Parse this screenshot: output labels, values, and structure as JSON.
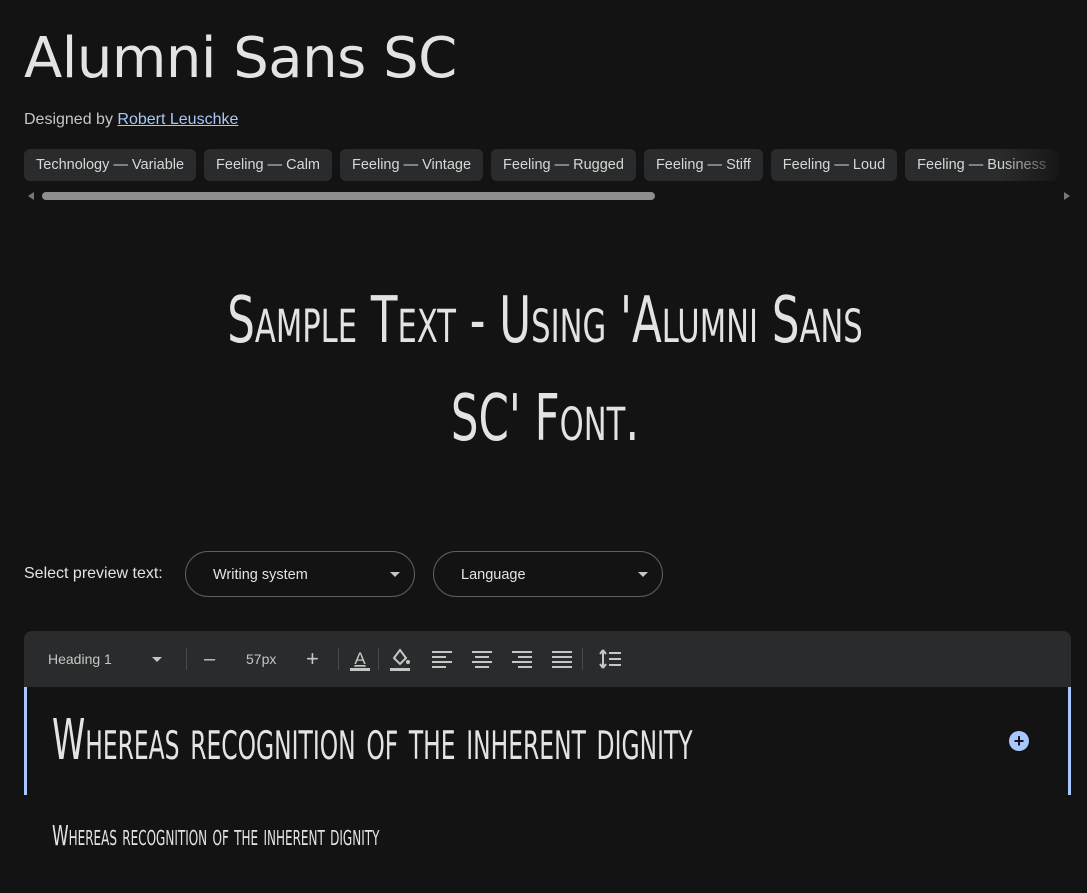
{
  "font": {
    "name": "Alumni Sans SC",
    "designed_by_label": "Designed by",
    "designer": "Robert Leuschke"
  },
  "tags": [
    "Technology — Variable",
    "Feeling — Calm",
    "Feeling — Vintage",
    "Feeling — Rugged",
    "Feeling — Stiff",
    "Feeling — Loud",
    "Feeling — Business"
  ],
  "sample_text": "Sample Text - Using 'Alumni Sans SC' Font.",
  "preview": {
    "label": "Select preview text:",
    "writing_system": "Writing system",
    "language": "Language"
  },
  "toolbar": {
    "style": "Heading 1",
    "decrease": "–",
    "size": "57px",
    "increase": "+",
    "icons": [
      "text-color-icon",
      "highlight-color-icon",
      "align-left-icon",
      "align-center-icon",
      "align-right-icon",
      "align-justify-icon",
      "line-spacing-icon"
    ]
  },
  "editor": {
    "heading_text": "Whereas recognition of the inherent dignity",
    "body_text": "Whereas recognition of the inherent dignity"
  },
  "colors": {
    "background": "#131314",
    "surface": "#2a2b2c",
    "accent": "#a8c7fa",
    "text": "#e3e3e3"
  }
}
